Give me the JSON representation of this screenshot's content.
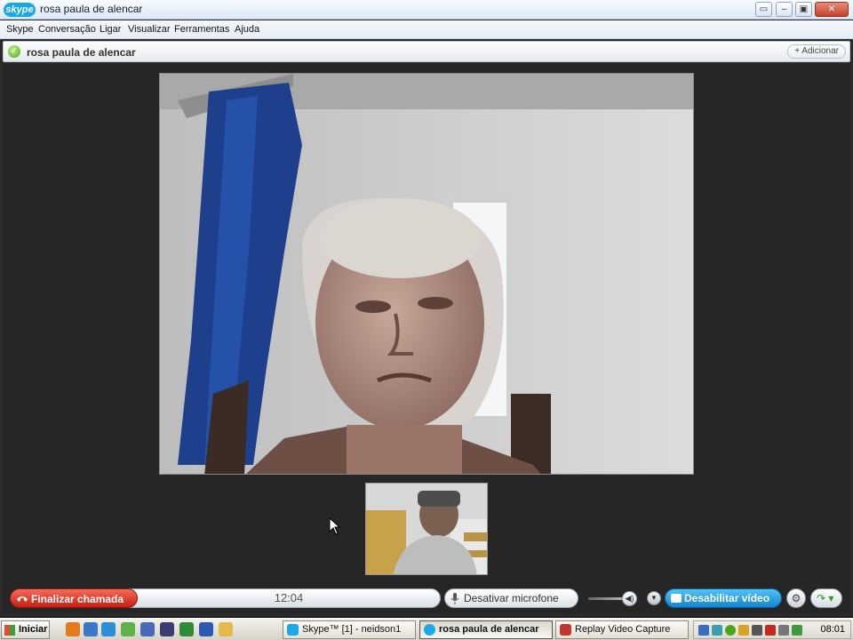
{
  "window": {
    "title": "rosa paula de alencar",
    "logo": "skype",
    "buttons": [
      "restore-down",
      "minimize",
      "maximize",
      "close"
    ]
  },
  "menu": [
    "Skype",
    "Conversação",
    "Ligar",
    "Visualizar",
    "Ferramentas",
    "Ajuda"
  ],
  "contact": {
    "name": "rosa paula de alencar",
    "status": "online",
    "add_label": "+ Adicionar"
  },
  "call": {
    "end_label": "Finalizar chamada",
    "timer": "12:04",
    "mute_label": "Desativar microfone",
    "video_label": "Desabilitar vídeo"
  },
  "taskbar": {
    "start_label": "Iniciar",
    "tasks": [
      {
        "label": "Skype™ [1] - neidson1",
        "icon": "skype-icon",
        "active": false
      },
      {
        "label": "rosa paula de alencar",
        "icon": "skype-icon",
        "active": true
      },
      {
        "label": "Replay Video Capture",
        "icon": "video-capture-icon",
        "active": false
      }
    ],
    "clock": "08:01"
  },
  "colors": {
    "accent": "#1ba8e6",
    "end_call": "#d8261a",
    "online": "#4aa61b"
  }
}
